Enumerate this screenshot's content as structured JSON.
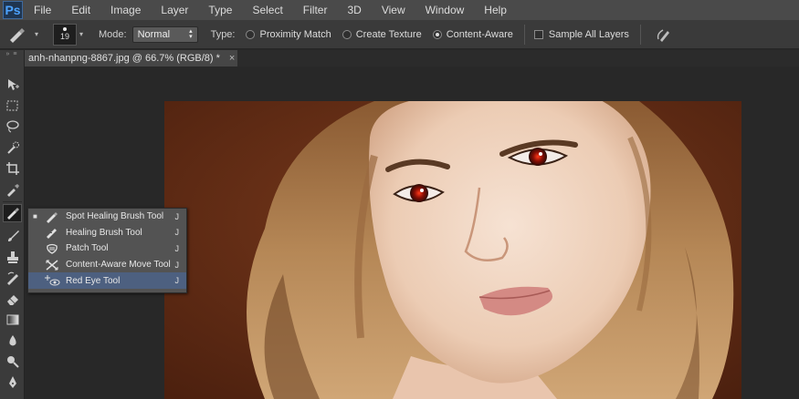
{
  "app": {
    "logo": "Ps"
  },
  "menu": [
    "File",
    "Edit",
    "Image",
    "Layer",
    "Type",
    "Select",
    "Filter",
    "3D",
    "View",
    "Window",
    "Help"
  ],
  "options": {
    "brush_size": "19",
    "mode_label": "Mode:",
    "mode_value": "Normal",
    "type_label": "Type:",
    "type_options": [
      {
        "label": "Proximity Match",
        "selected": false
      },
      {
        "label": "Create Texture",
        "selected": false
      },
      {
        "label": "Content-Aware",
        "selected": true
      }
    ],
    "sample_all_layers": {
      "label": "Sample All Layers",
      "checked": false
    }
  },
  "document": {
    "tab_title": "anh-nhanpng-8867.jpg @ 66.7% (RGB/8) *",
    "close": "×"
  },
  "flyout": {
    "items": [
      {
        "label": "Spot Healing Brush Tool",
        "key": "J",
        "icon": "spot-healing-brush-icon",
        "active": true,
        "selected": false
      },
      {
        "label": "Healing Brush Tool",
        "key": "J",
        "icon": "healing-brush-icon",
        "active": false,
        "selected": false
      },
      {
        "label": "Patch Tool",
        "key": "J",
        "icon": "patch-icon",
        "active": false,
        "selected": false
      },
      {
        "label": "Content-Aware Move Tool",
        "key": "J",
        "icon": "content-aware-move-icon",
        "active": false,
        "selected": false
      },
      {
        "label": "Red Eye Tool",
        "key": "J",
        "icon": "red-eye-icon",
        "active": false,
        "selected": true
      }
    ]
  },
  "toolbar_tools": [
    "move-icon",
    "marquee-icon",
    "lasso-icon",
    "quick-selection-icon",
    "crop-icon",
    "eyedropper-icon",
    "spot-healing-brush-icon",
    "brush-icon",
    "clone-stamp-icon",
    "history-brush-icon",
    "eraser-icon",
    "gradient-icon",
    "blur-icon",
    "dodge-icon",
    "pen-icon"
  ],
  "colors": {
    "menu_bg": "#4a4a4a",
    "options_bg": "#3a3a3a",
    "canvas_bg": "#282828",
    "flyout_selected": "#4d6080",
    "photo_bg": "#5a2814"
  }
}
